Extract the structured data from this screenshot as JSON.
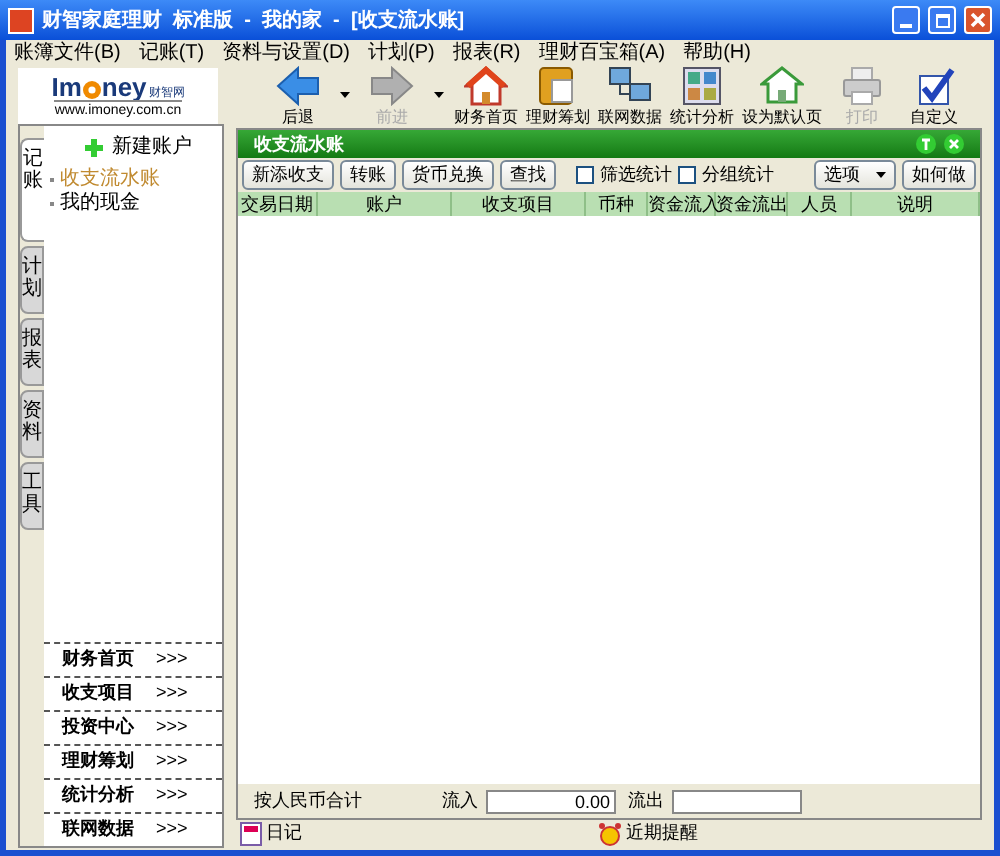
{
  "window": {
    "title": "财智家庭理财  标准版  -  我的家  -  [收支流水账]"
  },
  "menu": [
    "账簿文件(B)",
    "记账(T)",
    "资料与设置(D)",
    "计划(P)",
    "报表(R)",
    "理财百宝箱(A)",
    "帮助(H)"
  ],
  "logo": {
    "brand_left": "Im",
    "brand_right": "ney",
    "brand_sub": "财智网",
    "url": "www.imoney.com.cn"
  },
  "toolbar": [
    {
      "label": "后退",
      "kind": "back",
      "disabled": false,
      "dropdown": true
    },
    {
      "label": "前进",
      "kind": "forward",
      "disabled": true,
      "dropdown": true
    },
    {
      "label": "财务首页",
      "kind": "home",
      "disabled": false,
      "dropdown": false
    },
    {
      "label": "理财筹划",
      "kind": "plan",
      "disabled": false,
      "dropdown": false
    },
    {
      "label": "联网数据",
      "kind": "network",
      "disabled": false,
      "dropdown": false
    },
    {
      "label": "统计分析",
      "kind": "stats",
      "disabled": false,
      "dropdown": false
    },
    {
      "label": "设为默认页",
      "kind": "defaultpage",
      "disabled": false,
      "dropdown": false
    },
    {
      "label": "打印",
      "kind": "print",
      "disabled": true,
      "dropdown": false
    },
    {
      "label": "自定义",
      "kind": "custom",
      "disabled": false,
      "dropdown": false
    }
  ],
  "side_tabs": [
    {
      "label": "记账",
      "selected": true
    },
    {
      "label": "计划",
      "selected": false
    },
    {
      "label": "报表",
      "selected": false
    },
    {
      "label": "资料",
      "selected": false
    },
    {
      "label": "工具",
      "selected": false
    }
  ],
  "new_account": "新建账户",
  "tree": [
    {
      "label": "收支流水账",
      "selected": true
    },
    {
      "label": "我的现金",
      "selected": false
    }
  ],
  "nav_links": [
    {
      "label": "财务首页",
      "more": ">>>"
    },
    {
      "label": "收支项目",
      "more": ">>>"
    },
    {
      "label": "投资中心",
      "more": ">>>"
    },
    {
      "label": "理财筹划",
      "more": ">>>"
    },
    {
      "label": "统计分析",
      "more": ">>>"
    },
    {
      "label": "联网数据",
      "more": ">>>"
    }
  ],
  "panel": {
    "title": "收支流水账",
    "buttons": [
      "新添收支",
      "转账",
      "货币兑换",
      "查找"
    ],
    "checkboxes": [
      {
        "label": "筛选统计",
        "checked": false
      },
      {
        "label": "分组统计",
        "checked": false
      }
    ],
    "options": "选项",
    "howto": "如何做",
    "columns": [
      "交易日期",
      "账户",
      "收支项目",
      "币种",
      "资金流入",
      "资金流出",
      "人员",
      "说明"
    ],
    "footer": {
      "label": "按人民币合计",
      "inflow_label": "流入",
      "inflow": "0.00",
      "outflow_label": "流出"
    }
  },
  "status_bar": [
    {
      "label": "日记",
      "kind": "diary"
    },
    {
      "label": "近期提醒",
      "kind": "alarm"
    }
  ]
}
